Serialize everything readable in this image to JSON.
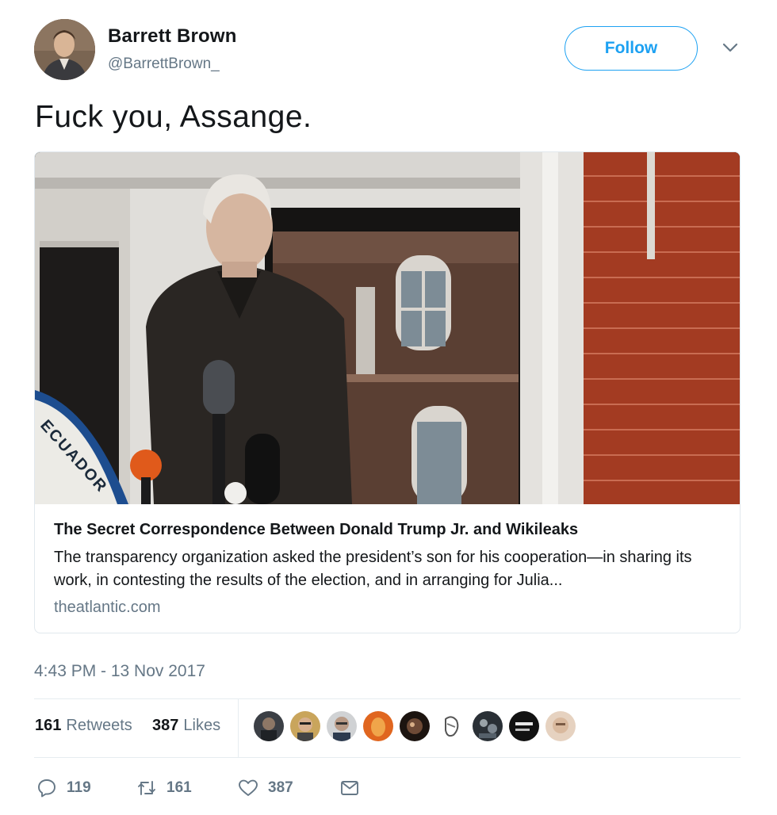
{
  "user": {
    "display_name": "Barrett Brown",
    "handle": "@BarrettBrown_"
  },
  "follow_label": "Follow",
  "tweet_text": "Fuck you, Assange.",
  "card": {
    "title": "The Secret Correspondence Between Donald Trump Jr. and Wikileaks",
    "description": "The transparency organization asked the president’s son for his cooperation—in sharing its work, in contesting the results of the election, and in arranging for Julia...",
    "domain": "theatlantic.com",
    "image_sign_text": "ECUADOR"
  },
  "timestamp": "4:43 PM - 13 Nov 2017",
  "stats": {
    "retweets_count": "161",
    "retweets_label": "Retweets",
    "likes_count": "387",
    "likes_label": "Likes"
  },
  "actions": {
    "replies": "119",
    "retweets": "161",
    "likes": "387"
  },
  "icons": [
    "chevron-down-icon",
    "reply-icon",
    "retweet-icon",
    "heart-icon",
    "message-icon"
  ],
  "colors": {
    "accent": "#1da1f2",
    "secondary_text": "#657786",
    "primary_text": "#14171a",
    "border": "#e1e8ed"
  }
}
